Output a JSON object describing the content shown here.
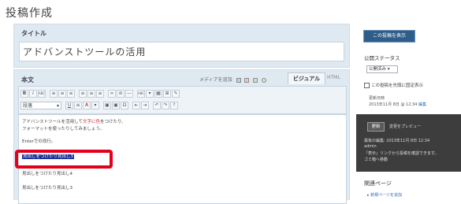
{
  "page": {
    "title": "投稿作成"
  },
  "title_panel": {
    "label": "タイトル",
    "value": "アドバンストツールの活用"
  },
  "body_panel": {
    "label": "本文",
    "upload_label": "メディアを追加",
    "visual_tab": "ビジュアル",
    "html_tab": "HTML",
    "format_select": "段落"
  },
  "toolbar": {
    "row1": [
      "B",
      "I",
      "ABC",
      "≡",
      "≡",
      "≡",
      "≡",
      "≡",
      "≡",
      "∞",
      "⊘",
      "—",
      "ABC",
      "▾",
      "▦",
      "⊞",
      "✎"
    ],
    "row2": [
      "U",
      "≡",
      "A",
      "▾",
      "▣",
      "▣",
      "Ω",
      "⇤",
      "⇥",
      "↶",
      "↷",
      "?"
    ]
  },
  "editor": {
    "line1_pre": "アドバンストツールを活用して",
    "line1_red": "文字に色",
    "line1_post": "をつけたり、",
    "line2": "フォーマットを使ったりしてみましょう。",
    "line3": "Enterでの改行。",
    "line4_selected": "見出しをつけたり見出し3",
    "line5": "見出しをつけたり見出し4",
    "line6": "見出しをつけたり見出し3"
  },
  "sidebar": {
    "show_button": "この投稿を表示",
    "status_label": "公開ステータス",
    "status_value": "公開済み",
    "sticky_check": "この投稿を先頭に固定表示",
    "update_label": "更新日時",
    "update_date": "2013年11月 8日 @ 12:34",
    "update_edit": "編集",
    "publish_button": "更新",
    "preview_link": "変更をプレビュー",
    "dark_line1": "最後の編集: 2013年11月 8日 12:34",
    "dark_line2": "admin",
    "dark_line3": "「表示」リンクから投稿を確認できます。",
    "dark_line4": "ゴミ箱へ移動",
    "related_label": "関連ページ",
    "related_link": "▸ 新規ページを追加"
  }
}
